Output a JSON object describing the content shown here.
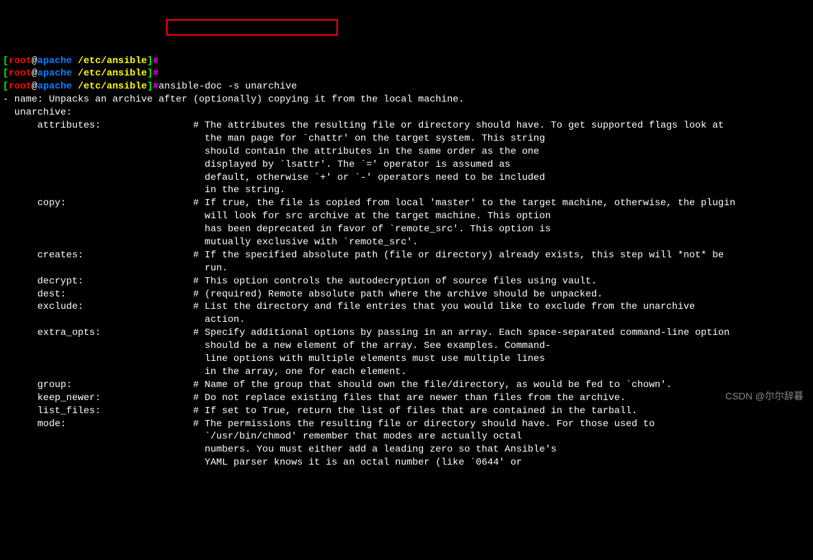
{
  "prompts": [
    {
      "user": "root",
      "host": "apache",
      "path": "/etc/ansible",
      "cmd": ""
    },
    {
      "user": "root",
      "host": "apache",
      "path": "/etc/ansible",
      "cmd": ""
    },
    {
      "user": "root",
      "host": "apache",
      "path": "/etc/ansible",
      "cmd": "ansible-doc -s unarchive"
    }
  ],
  "doc": {
    "name_line": "- name: Unpacks an archive after (optionally) copying it from the local machine.",
    "module_line": "  unarchive:",
    "params": [
      {
        "name": "attributes",
        "desc": [
          "The attributes the resulting file or directory should have. To get supported flags look at",
          "the man page for `chattr' on the target system. This string",
          "should contain the attributes in the same order as the one",
          "displayed by `lsattr'. The `=' operator is assumed as",
          "default, otherwise `+' or `-' operators need to be included",
          "in the string."
        ]
      },
      {
        "name": "copy",
        "desc": [
          "If true, the file is copied from local 'master' to the target machine, otherwise, the plugin",
          "will look for src archive at the target machine. This option",
          "has been deprecated in favor of `remote_src'. This option is",
          "mutually exclusive with `remote_src'."
        ]
      },
      {
        "name": "creates",
        "desc": [
          "If the specified absolute path (file or directory) already exists, this step will *not* be",
          "run."
        ]
      },
      {
        "name": "decrypt",
        "desc": [
          "This option controls the autodecryption of source files using vault."
        ]
      },
      {
        "name": "dest",
        "desc": [
          "(required) Remote absolute path where the archive should be unpacked."
        ]
      },
      {
        "name": "exclude",
        "desc": [
          "List the directory and file entries that you would like to exclude from the unarchive",
          "action."
        ]
      },
      {
        "name": "extra_opts",
        "desc": [
          "Specify additional options by passing in an array. Each space-separated command-line option",
          "should be a new element of the array. See examples. Command-",
          "line options with multiple elements must use multiple lines",
          "in the array, one for each element."
        ]
      },
      {
        "name": "group",
        "desc": [
          "Name of the group that should own the file/directory, as would be fed to `chown'."
        ]
      },
      {
        "name": "keep_newer",
        "desc": [
          "Do not replace existing files that are newer than files from the archive."
        ]
      },
      {
        "name": "list_files",
        "desc": [
          "If set to True, return the list of files that are contained in the tarball."
        ]
      },
      {
        "name": "mode",
        "desc": [
          "The permissions the resulting file or directory should have. For those used to",
          "`/usr/bin/chmod' remember that modes are actually octal",
          "numbers. You must either add a leading zero so that Ansible's",
          "YAML parser knows it is an octal number (like `0644' or"
        ]
      }
    ]
  },
  "watermark": "CSDN @尔尔辞暮"
}
